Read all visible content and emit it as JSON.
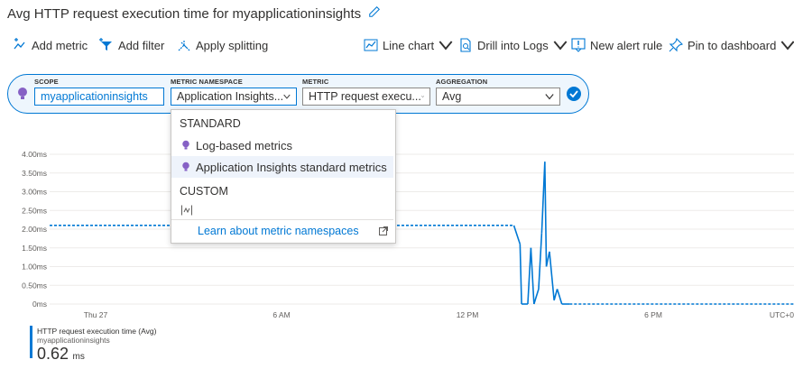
{
  "header": {
    "title": "Avg HTTP request execution time for myapplicationinsights"
  },
  "toolbar": {
    "add_metric": "Add metric",
    "add_filter": "Add filter",
    "apply_splitting": "Apply splitting",
    "line_chart": "Line chart",
    "drill_logs": "Drill into Logs",
    "new_alert": "New alert rule",
    "pin_dashboard": "Pin to dashboard"
  },
  "builder": {
    "scope_label": "SCOPE",
    "scope_value": "myapplicationinsights",
    "namespace_label": "METRIC NAMESPACE",
    "namespace_value": "Application Insights...",
    "metric_label": "METRIC",
    "metric_value": "HTTP request execu...",
    "aggregation_label": "AGGREGATION",
    "aggregation_value": "Avg"
  },
  "dropdown": {
    "standard_header": "STANDARD",
    "items": [
      {
        "label": "Log-based metrics",
        "selected": false
      },
      {
        "label": "Application Insights standard metrics",
        "selected": true
      }
    ],
    "custom_header": "CUSTOM",
    "learn_link": "Learn about metric namespaces"
  },
  "chart_data": {
    "type": "line",
    "unit": "ms",
    "y_ticks": [
      "4.00ms",
      "3.50ms",
      "3.00ms",
      "2.50ms",
      "2.00ms",
      "1.50ms",
      "1.00ms",
      "0.50ms",
      "0ms"
    ],
    "ylim": [
      0,
      4.0
    ],
    "x_ticks": [
      "Thu 27",
      "6 AM",
      "12 PM",
      "6 PM",
      "UTC+0"
    ],
    "series": [
      {
        "name": "HTTP request execution time (Avg)",
        "color": "#0078d4",
        "points_hours": [
          {
            "h": -3.3,
            "v": 2.1,
            "dashed": true
          },
          {
            "h": 13.5,
            "v": 2.1,
            "dashed": true
          },
          {
            "h": 13.7,
            "v": 1.6
          },
          {
            "h": 13.75,
            "v": 0
          },
          {
            "h": 13.95,
            "v": 0
          },
          {
            "h": 14.05,
            "v": 1.5
          },
          {
            "h": 14.15,
            "v": 0
          },
          {
            "h": 14.3,
            "v": 0.4
          },
          {
            "h": 14.4,
            "v": 1.9
          },
          {
            "h": 14.5,
            "v": 3.8
          },
          {
            "h": 14.55,
            "v": 1.0
          },
          {
            "h": 14.65,
            "v": 1.4
          },
          {
            "h": 14.8,
            "v": 0.1
          },
          {
            "h": 14.9,
            "v": 0.4
          },
          {
            "h": 15.05,
            "v": 0
          },
          {
            "h": 15.3,
            "v": 0,
            "dashed": true
          },
          {
            "h": 26.5,
            "v": 0,
            "dashed": true
          }
        ]
      }
    ]
  },
  "legend": {
    "title": "HTTP request execution time (Avg)",
    "subtitle": "myapplicationinsights",
    "value": "0.62",
    "unit": "ms"
  }
}
